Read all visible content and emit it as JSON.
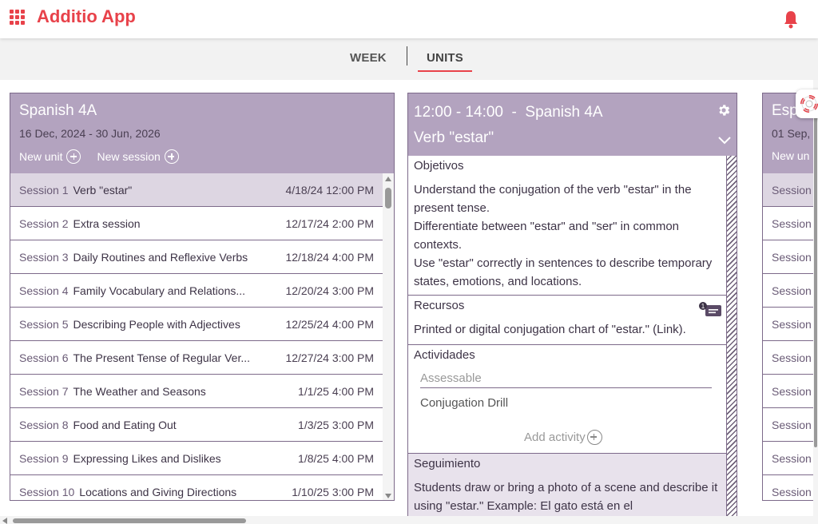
{
  "app": {
    "title": "Additio App"
  },
  "tabs": {
    "week": "WEEK",
    "units": "UNITS"
  },
  "unit": {
    "title": "Spanish 4A",
    "dates": "16 Dec, 2024 - 30 Jun, 2026",
    "new_unit": "New unit",
    "new_session": "New session",
    "sessions": [
      {
        "num": "Session 1",
        "name": "Verb \"estar\"",
        "date": "4/18/24 12:00 PM"
      },
      {
        "num": "Session 2",
        "name": "Extra session",
        "date": "12/17/24 2:00 PM"
      },
      {
        "num": "Session 3",
        "name": "Daily Routines and Reflexive Verbs",
        "date": "12/18/24 4:00 PM"
      },
      {
        "num": "Session 4",
        "name": "Family Vocabulary and Relations...",
        "date": "12/20/24 3:00 PM"
      },
      {
        "num": "Session 5",
        "name": "Describing People with Adjectives",
        "date": "12/25/24 4:00 PM"
      },
      {
        "num": "Session 6",
        "name": "The Present Tense of Regular Ver...",
        "date": "12/27/24 3:00 PM"
      },
      {
        "num": "Session 7",
        "name": "The Weather and Seasons",
        "date": "1/1/25 4:00 PM"
      },
      {
        "num": "Session 8",
        "name": "Food and Eating Out",
        "date": "1/3/25 3:00 PM"
      },
      {
        "num": "Session 9",
        "name": "Expressing Likes and Dislikes",
        "date": "1/8/25 4:00 PM"
      },
      {
        "num": "Session 10",
        "name": "Locations and Giving Directions",
        "date": "1/10/25 3:00 PM"
      }
    ]
  },
  "session_detail": {
    "time": "12:00 - 14:00  -  Spanish 4A",
    "name": "Verb \"estar\"",
    "objetivos": {
      "title": "Objetivos",
      "lines": [
        "Understand the conjugation of the verb \"estar\" in the present tense.",
        "Differentiate between \"estar\" and \"ser\" in common contexts.",
        "Use \"estar\" correctly in sentences to describe temporary states, emotions, and locations."
      ]
    },
    "recursos": {
      "title": "Recursos",
      "text": "Printed or digital conjugation chart of \"estar.\" (Link).",
      "comment_count": "1"
    },
    "actividades": {
      "title": "Actividades",
      "field_placeholder": "Assessable",
      "item": "Conjugation Drill",
      "add_label": "Add activity"
    },
    "seguimiento": {
      "title": "Seguimiento",
      "text": "Students draw or bring a photo of a scene and describe it using \"estar.\" Example: El gato está en el"
    }
  },
  "peek": {
    "title": "Esp",
    "dates": "01 Sep,",
    "action": "New un",
    "row_label": "Session"
  },
  "colors": {
    "brand": "#e8424a",
    "header_purple": "#b3a3bf",
    "border_purple": "#7d6a8a"
  }
}
